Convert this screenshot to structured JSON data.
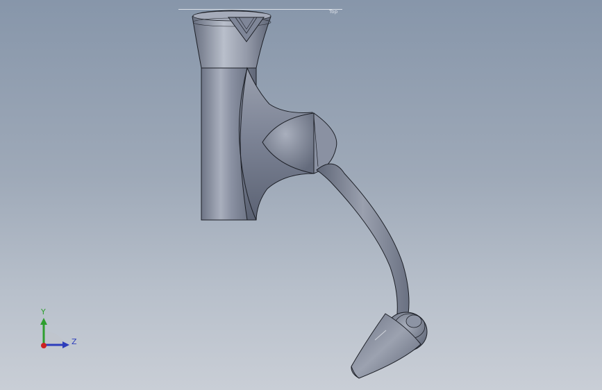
{
  "viewport": {
    "background_top": "#8796aa",
    "background_bottom": "#c9ced6"
  },
  "model": {
    "body_color": "#7c8394",
    "highlight_color": "#c3c8d3",
    "edge_color": "#1c1f26"
  },
  "reference_plane": {
    "label": "Top"
  },
  "triad": {
    "y_label": "Y",
    "z_label": "Z",
    "y_color": "#2f9e2f",
    "z_color": "#2d3dbb",
    "origin_color": "#cc2222"
  }
}
